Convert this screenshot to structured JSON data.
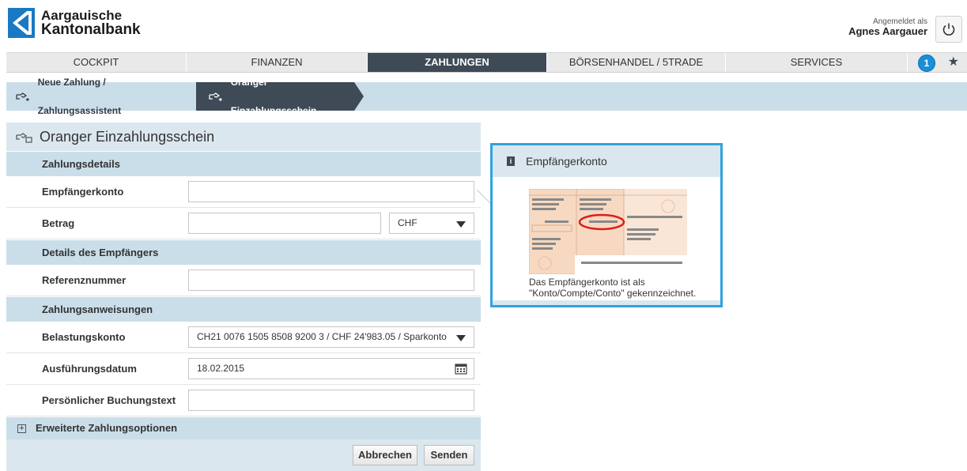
{
  "header": {
    "bank_name_line1": "Aargauische",
    "bank_name_line2": "Kantonalbank",
    "logged_in_label": "Angemeldet als",
    "user_name": "Agnes Aargauer"
  },
  "nav": {
    "items": [
      "COCKPIT",
      "FINANZEN",
      "ZAHLUNGEN",
      "BÖRSENHANDEL / 5TRADE",
      "SERVICES"
    ],
    "active": "ZAHLUNGEN",
    "badge_count": "1"
  },
  "breadcrumb": {
    "step1": "Neue Zahlung / Zahlungsassistent",
    "step2": "Oranger Einzahlungsschein"
  },
  "form": {
    "title": "Oranger Einzahlungsschein",
    "section_payment": "Zahlungsdetails",
    "label_account": "Empfängerkonto",
    "label_amount": "Betrag",
    "currency": "CHF",
    "section_recipient": "Details des Empfängers",
    "label_reference": "Referenznummer",
    "section_instructions": "Zahlungsanweisungen",
    "label_debit": "Belastungskonto",
    "debit_account": "CH21 0076 1505 8508 9200 3 / CHF 24'983.05 / Sparkonto",
    "label_date": "Ausführungsdatum",
    "date_value": "18.02.2015",
    "label_booking": "Persönlicher Buchungstext",
    "extended_options": "Erweiterte Zahlungsoptionen",
    "btn_cancel": "Abbrechen",
    "btn_send": "Senden"
  },
  "info": {
    "title": "Empfängerkonto",
    "text_line1": "Das Empfängerkonto ist als",
    "text_line2": "\"Konto/Compte/Conto\" gekennzeichnet."
  },
  "colors": {
    "brand_blue": "#1a79c2",
    "nav_active": "#3e4a55",
    "section_bg": "#c9dee8",
    "info_border": "#2ea3df"
  }
}
